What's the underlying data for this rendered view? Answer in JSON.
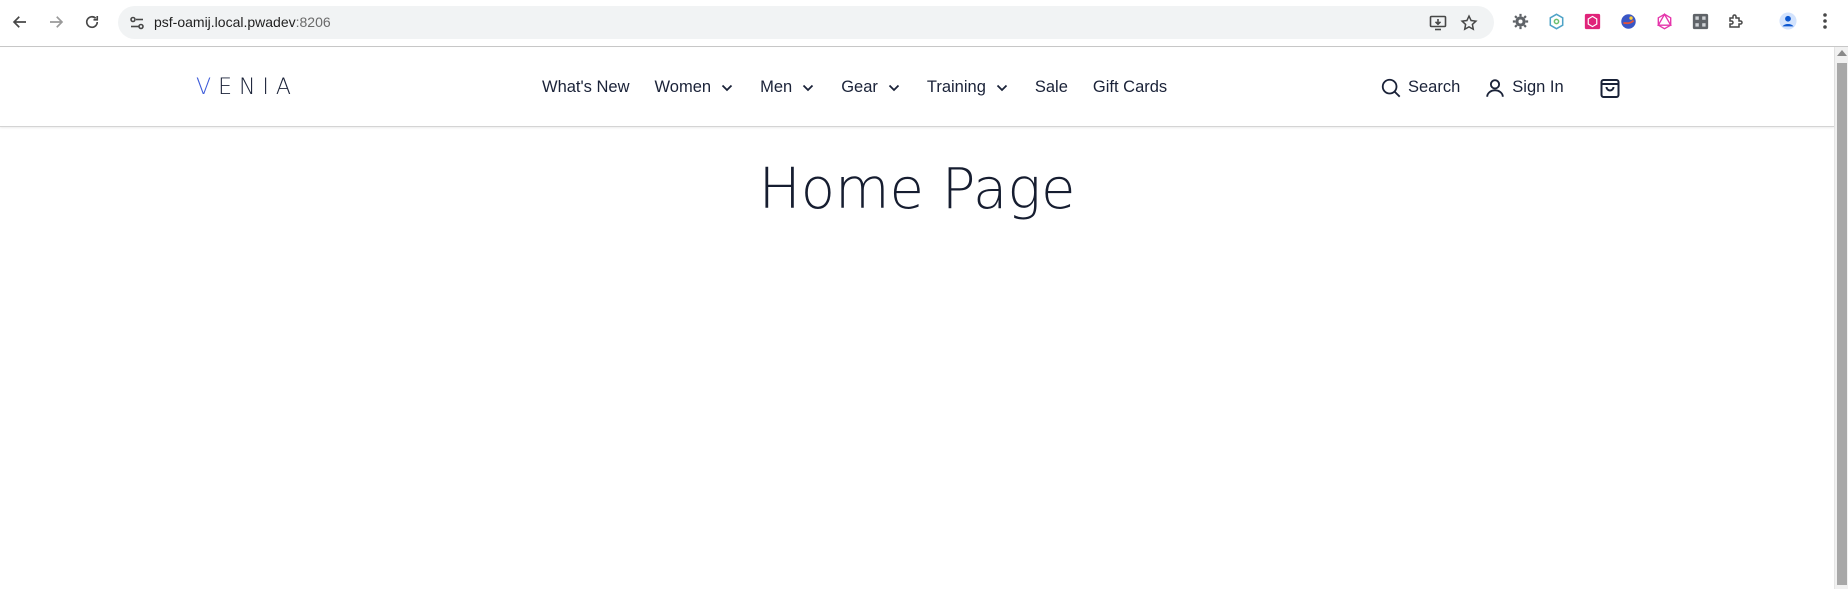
{
  "browser": {
    "url_host": "psf-oamij.local.pwadev",
    "url_port": ":8206",
    "icons": {
      "back": "arrow-left-icon",
      "forward": "arrow-right-icon",
      "reload": "reload-icon",
      "site_info": "site-settings-icon",
      "install": "install-app-icon",
      "bookmark": "star-icon",
      "extensions": [
        "gear-extension-icon",
        "hexagon-extension-icon",
        "pink-extension-icon",
        "globe-extension-icon",
        "graphql-extension-icon",
        "grid-extension-icon",
        "puzzle-icon"
      ],
      "profile": "profile-icon",
      "menu": "kebab-menu-icon"
    }
  },
  "header": {
    "logo": {
      "first_letter": "V",
      "rest": "ENIA"
    },
    "nav": [
      {
        "label": "What's New",
        "has_dropdown": false
      },
      {
        "label": "Women",
        "has_dropdown": true
      },
      {
        "label": "Men",
        "has_dropdown": true
      },
      {
        "label": "Gear",
        "has_dropdown": true
      },
      {
        "label": "Training",
        "has_dropdown": true
      },
      {
        "label": "Sale",
        "has_dropdown": false
      },
      {
        "label": "Gift Cards",
        "has_dropdown": false
      }
    ],
    "search_label": "Search",
    "signin_label": "Sign In",
    "cart_icon": "shopping-bag-icon"
  },
  "main": {
    "title": "Home Page"
  },
  "colors": {
    "text": "#1a2238",
    "logo_accent": "#3d5bd9",
    "omnibox_bg": "#f1f3f4"
  }
}
